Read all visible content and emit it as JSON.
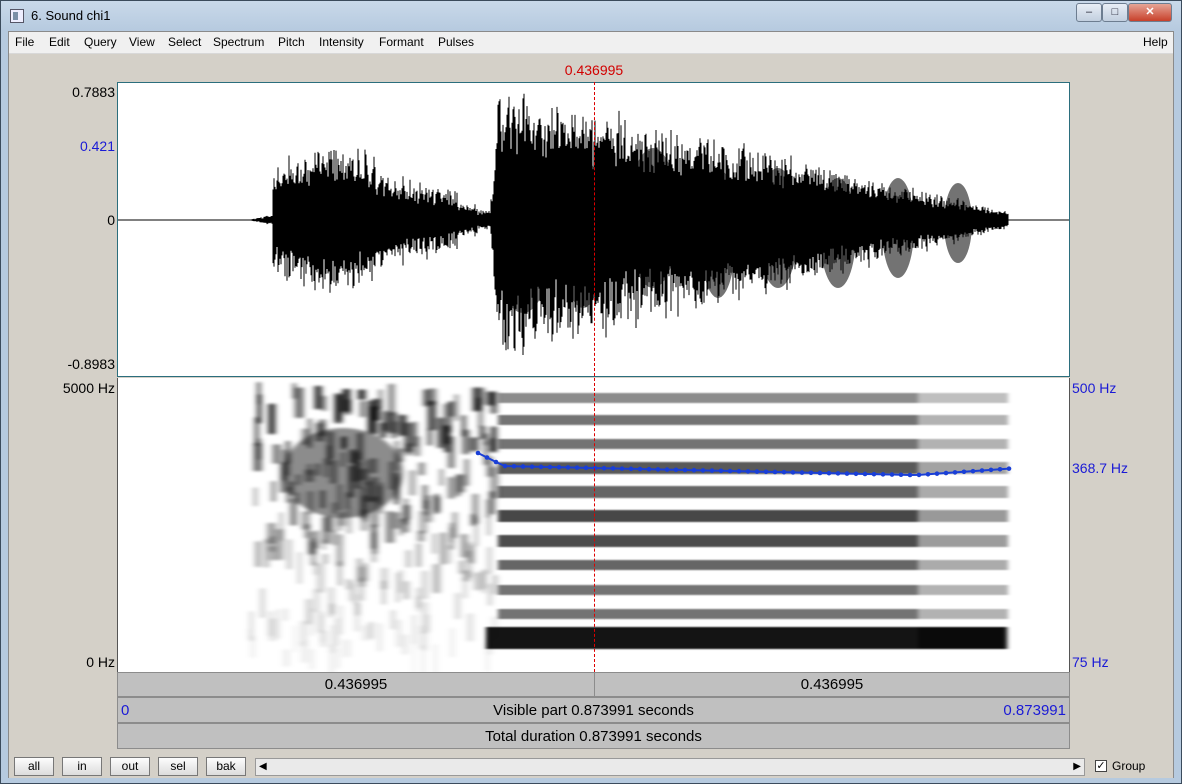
{
  "window": {
    "title": "6. Sound chi1",
    "minimize": "–",
    "maximize": "□",
    "close": "✕"
  },
  "menu": [
    "File",
    "Edit",
    "Query",
    "View",
    "Select",
    "Spectrum",
    "Pitch",
    "Intensity",
    "Formant",
    "Pulses"
  ],
  "help": "Help",
  "cursor_time": "0.436995",
  "waveform": {
    "y_max": "0.7883",
    "y_mark": "0.421",
    "y_zero": "0",
    "y_min": "-0.8983"
  },
  "spectrogram": {
    "freq_top": "5000 Hz",
    "freq_bottom": "0 Hz",
    "pitch_top": "500 Hz",
    "pitch_value": "368.7 Hz",
    "pitch_bottom": "75 Hz"
  },
  "segments": {
    "left": "0.436995",
    "right": "0.436995"
  },
  "visible": {
    "start": "0",
    "label": "Visible part 0.873991 seconds",
    "end": "0.873991"
  },
  "total": "Total duration 0.873991 seconds",
  "buttons": [
    "all",
    "in",
    "out",
    "sel",
    "bak"
  ],
  "group_label": "Group",
  "colors": {
    "pitch": "#1a3fd6",
    "cursor": "#d20000",
    "axis_blue": "#1a1ad6"
  }
}
